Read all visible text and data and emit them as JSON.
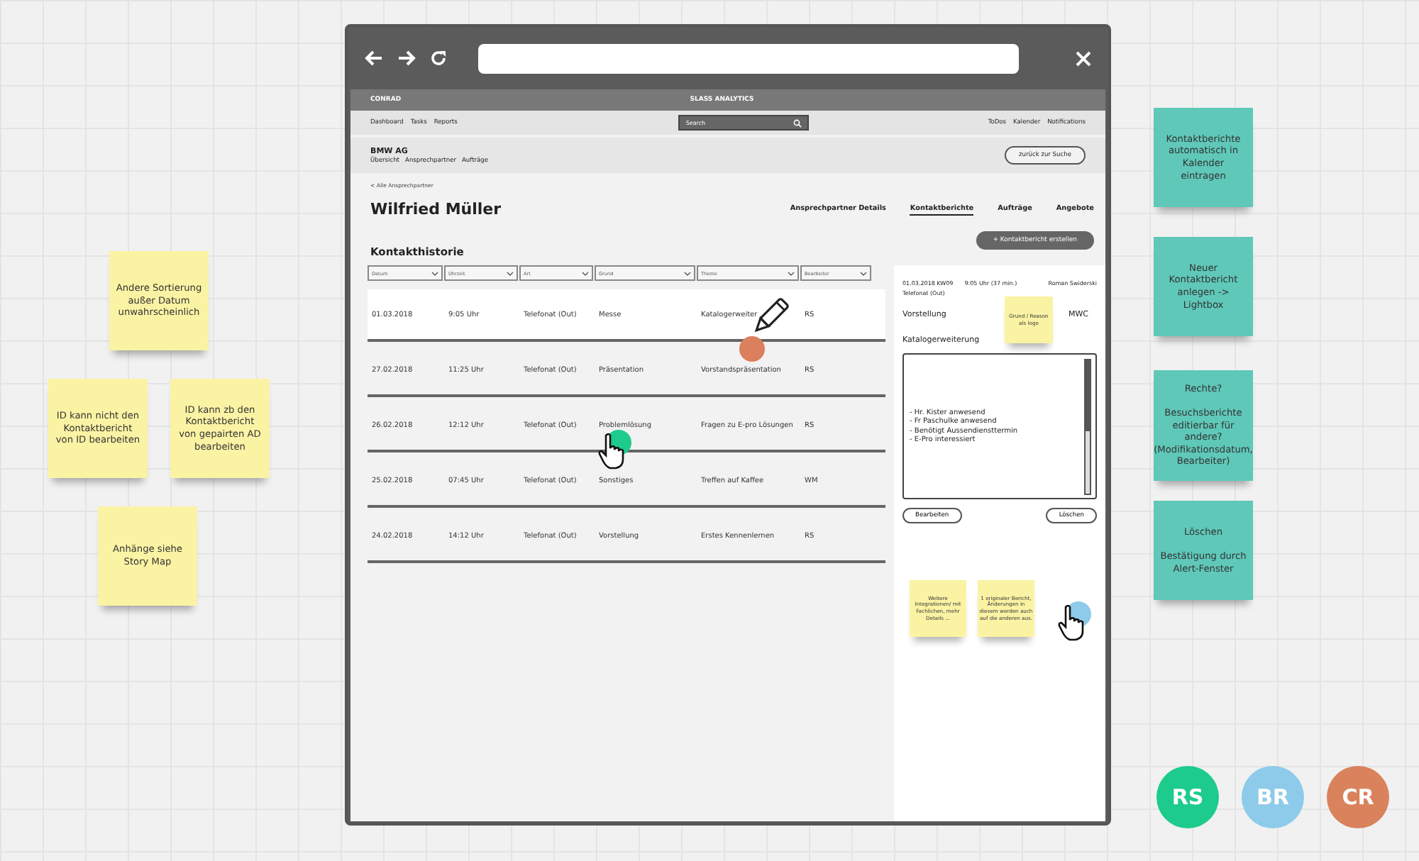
{
  "sticky_notes": [
    {
      "text": "Andere Sortierung außer Datum unwahrscheinlich",
      "color": "#fbf3a4"
    },
    {
      "text": "ID kann nicht den Kontaktbericht von ID bearbeiten",
      "color": "#fbf3a4"
    },
    {
      "text": "ID kann zb den Kontaktbericht von gepairten AD bearbeiten",
      "color": "#fbf3a4"
    },
    {
      "text": "Anhänge siehe Story Map",
      "color": "#fbf3a4"
    },
    {
      "text": "Kontaktberichte automatisch in Kalender eintragen",
      "color": "#5fc8b9"
    },
    {
      "text": "Neuer Kontaktbericht anlegen -> Lightbox",
      "color": "#5fc8b9"
    },
    {
      "text": "Rechte?\n\nBesuchsberichte editierbar für andere? (Modifikationsdatum, Bearbeiter)",
      "color": "#5fc8b9"
    },
    {
      "text": "Löschen\n\nBestätigung durch Alert-Fenster",
      "color": "#5fc8b9"
    }
  ],
  "app": {
    "brand": "CONRAD",
    "title": "SLASS ANALYTICS",
    "nav": [
      "Dashboard",
      "Tasks",
      "Reports"
    ],
    "search": {
      "placeholder": "Search"
    },
    "right_links": [
      "ToDos",
      "Kalender",
      "Notifications"
    ],
    "company": "BMW AG",
    "company_nav": [
      "Übersicht",
      "Ansprechpartner",
      "Aufträge"
    ],
    "back_button": "zurück zur Suche",
    "breadcrumb": "< Alle Ansprechpartner",
    "contact_name": "Wilfried Müller",
    "tabs": [
      {
        "label": "Ansprechpartner Details",
        "selected": false
      },
      {
        "label": "Kontaktberichte",
        "selected": true
      },
      {
        "label": "Aufträge",
        "selected": false
      },
      {
        "label": "Angebote",
        "selected": false
      }
    ],
    "section_title": "Kontakthistorie",
    "create_button": "+ Kontaktbericht erstellen",
    "table": {
      "columns": [
        "Datum",
        "Uhrzeit",
        "Art",
        "Grund",
        "Theme",
        "Bearbeiter"
      ],
      "rows": [
        {
          "cells": [
            "01.03.2018",
            "9:05 Uhr",
            "Telefonat (Out)",
            "Messe",
            "Katalogerweiter",
            "RS"
          ],
          "selected": true
        },
        {
          "cells": [
            "27.02.2018",
            "11:25 Uhr",
            "Telefonat (Out)",
            "Präsentation",
            "Vorstandspräsentation",
            "RS"
          ],
          "selected": false
        },
        {
          "cells": [
            "26.02.2018",
            "12:12 Uhr",
            "Telefonat (Out)",
            "Problemlösung",
            "Fragen zu E-pro Lösungen",
            "RS"
          ],
          "selected": false
        },
        {
          "cells": [
            "25.02.2018",
            "07:45 Uhr",
            "Telefonat (Out)",
            "Sonstiges",
            "Treffen auf Kaffee",
            "WM"
          ],
          "selected": false
        },
        {
          "cells": [
            "24.02.2018",
            "14:12 Uhr",
            "Telefonat (Out)",
            "Vorstellung",
            "Erstes Kennenlernen",
            "RS"
          ],
          "selected": false
        }
      ]
    },
    "detail": {
      "date": "01.03.2018 KW09",
      "time": "9:05 Uhr (37 min.)",
      "person": "Roman Swiderski",
      "type": "Telefonat (Out)",
      "reason": "Vorstellung",
      "code": "MWC",
      "topic": "Katalogerweiterung",
      "notes": [
        "- Hr. Kister anwesend",
        "- Fr Paschulke anwesend",
        "- Benötigt Aussendiensttermin",
        "- E-Pro interessiert"
      ],
      "buttons": [
        "Bearbeiten",
        "Löschen"
      ]
    },
    "panel_notes": [
      {
        "text": "Grund / Reason als logo"
      },
      {
        "text": "Weitere Integrationen/ mit Fachlichen, mehr Details ..."
      },
      {
        "text": "1 originaler Bericht, Änderungen in diesem werden auch auf die anderen aus."
      }
    ]
  },
  "cursors": [
    {
      "kind": "pencil",
      "color": "#dc7f5c"
    },
    {
      "kind": "hand",
      "color": "#1dcc8c"
    },
    {
      "kind": "hand",
      "color": "#8ecbea"
    }
  ],
  "avatars": [
    {
      "initials": "RS",
      "color": "#1dcc8c"
    },
    {
      "initials": "BR",
      "color": "#8ecbea"
    },
    {
      "initials": "CR",
      "color": "#d9825c"
    }
  ]
}
